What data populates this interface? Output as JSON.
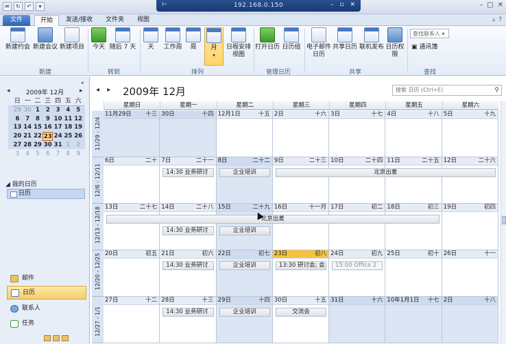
{
  "window": {
    "remote_ip": "192.168.0.150",
    "remote_controls": [
      "–",
      "▫",
      "✕"
    ],
    "controls": [
      "–",
      "□",
      "✕"
    ]
  },
  "ribbon_tabs": [
    {
      "label": "文件",
      "kind": "file"
    },
    {
      "label": "开始",
      "kind": "active"
    },
    {
      "label": "发送/接收",
      "kind": "normal"
    },
    {
      "label": "文件夹",
      "kind": "normal"
    },
    {
      "label": "视图",
      "kind": "normal"
    }
  ],
  "ribbon": {
    "buttons": [
      {
        "label": "新建约会",
        "icon": "new-appointment-icon"
      },
      {
        "label": "新建会议",
        "icon": "new-meeting-icon"
      },
      {
        "label": "新建项目",
        "icon": "new-items-icon"
      },
      {
        "label": "今天",
        "icon": "today-icon"
      },
      {
        "label": "随后 7 天",
        "icon": "next-7-days-icon"
      },
      {
        "label": "天",
        "icon": "day-view-icon"
      },
      {
        "label": "工作周",
        "icon": "work-week-icon"
      },
      {
        "label": "周",
        "icon": "week-icon"
      },
      {
        "label": "月",
        "icon": "month-icon",
        "selected": true
      },
      {
        "label": "日程安排视图",
        "icon": "schedule-view-icon"
      },
      {
        "label": "打开日历",
        "icon": "open-calendar-icon"
      },
      {
        "label": "日历组",
        "icon": "calendar-groups-icon"
      },
      {
        "label": "电子邮件日历",
        "icon": "email-calendar-icon"
      },
      {
        "label": "共享日历",
        "icon": "share-calendar-icon"
      },
      {
        "label": "联机发布",
        "icon": "publish-online-icon"
      },
      {
        "label": "日历权限",
        "icon": "calendar-permissions-icon"
      }
    ],
    "groups": [
      "新建",
      "转到",
      "排列",
      "管理日历",
      "共享",
      "查找"
    ],
    "find_placeholder": "查找联系人",
    "address_book": "通讯簿"
  },
  "mini_calendar": {
    "title": "2009年 12月",
    "weekdays": [
      "日",
      "一",
      "二",
      "三",
      "四",
      "五",
      "六"
    ],
    "weeks": [
      [
        "29",
        "30",
        "1",
        "2",
        "3",
        "4",
        "5"
      ],
      [
        "6",
        "7",
        "8",
        "9",
        "10",
        "11",
        "12"
      ],
      [
        "13",
        "14",
        "15",
        "16",
        "17",
        "18",
        "19"
      ],
      [
        "20",
        "21",
        "22",
        "23",
        "24",
        "25",
        "26"
      ],
      [
        "27",
        "28",
        "29",
        "30",
        "31",
        "1",
        "2"
      ],
      [
        "3",
        "4",
        "5",
        "6",
        "7",
        "8",
        "9"
      ]
    ],
    "today": "23"
  },
  "nav": {
    "my_calendars": "我的日历",
    "calendar_item": "日历",
    "buttons": [
      {
        "label": "邮件",
        "selected": false
      },
      {
        "label": "日历",
        "selected": true
      },
      {
        "label": "联系人",
        "selected": false
      },
      {
        "label": "任务",
        "selected": false
      }
    ]
  },
  "calendar": {
    "title": "2009年 12月",
    "search_placeholder": "搜索 日历 (Ctrl+E)",
    "weekdays": [
      "星期日",
      "星期一",
      "星期二",
      "星期三",
      "星期四",
      "星期五",
      "星期六"
    ],
    "week_labels": [
      "11/29 - 12/4",
      "12/6 - 12/11",
      "12/13 - 12/18",
      "12/20 - 12/25",
      "12/27 - 1/1"
    ],
    "weeks": [
      [
        {
          "day": "11月29日",
          "lunar": "十三",
          "off": true
        },
        {
          "day": "30日",
          "lunar": "十四",
          "off": true
        },
        {
          "day": "12月1日",
          "lunar": "十五"
        },
        {
          "day": "2日",
          "lunar": "十六"
        },
        {
          "day": "3日",
          "lunar": "十七"
        },
        {
          "day": "4日",
          "lunar": "十八"
        },
        {
          "day": "5日",
          "lunar": "十九"
        }
      ],
      [
        {
          "day": "6日",
          "lunar": "二十"
        },
        {
          "day": "7日",
          "lunar": "二十一"
        },
        {
          "day": "8日",
          "lunar": "二十二",
          "off": true
        },
        {
          "day": "9日",
          "lunar": "二十三"
        },
        {
          "day": "10日",
          "lunar": "二十四"
        },
        {
          "day": "11日",
          "lunar": "二十五"
        },
        {
          "day": "12日",
          "lunar": "二十六"
        }
      ],
      [
        {
          "day": "13日",
          "lunar": "二十七"
        },
        {
          "day": "14日",
          "lunar": "二十八"
        },
        {
          "day": "15日",
          "lunar": "二十九",
          "off": true
        },
        {
          "day": "16日",
          "lunar": "十一月"
        },
        {
          "day": "17日",
          "lunar": "初二"
        },
        {
          "day": "18日",
          "lunar": "初三"
        },
        {
          "day": "19日",
          "lunar": "初四"
        }
      ],
      [
        {
          "day": "20日",
          "lunar": "初五"
        },
        {
          "day": "21日",
          "lunar": "初六"
        },
        {
          "day": "22日",
          "lunar": "初七",
          "off": true
        },
        {
          "day": "23日",
          "lunar": "初八",
          "today": true
        },
        {
          "day": "24日",
          "lunar": "初九"
        },
        {
          "day": "25日",
          "lunar": "初十"
        },
        {
          "day": "26日",
          "lunar": "十一"
        }
      ],
      [
        {
          "day": "27日",
          "lunar": "十二"
        },
        {
          "day": "28日",
          "lunar": "十三"
        },
        {
          "day": "29日",
          "lunar": "十四",
          "off": true
        },
        {
          "day": "30日",
          "lunar": "十五"
        },
        {
          "day": "31日",
          "lunar": "十六",
          "off": true
        },
        {
          "day": "10年1月1日",
          "lunar": "十七",
          "off": true
        },
        {
          "day": "2日",
          "lunar": "十八",
          "off": true
        }
      ]
    ],
    "events": [
      {
        "week": 1,
        "start": 1,
        "span": 1,
        "text": "14:30 业务研讨"
      },
      {
        "week": 1,
        "start": 2,
        "span": 1,
        "text": "企业培训",
        "center": true
      },
      {
        "week": 1,
        "start": 3,
        "span": 4,
        "text": "北京出差",
        "center": true
      },
      {
        "week": 2,
        "start": 0,
        "span": 6,
        "text": "北京出差",
        "center": true,
        "row": 0
      },
      {
        "week": 2,
        "start": 1,
        "span": 1,
        "text": "14:30 业务研讨",
        "row": 1
      },
      {
        "week": 2,
        "start": 2,
        "span": 1,
        "text": "企业培训",
        "center": true,
        "row": 1
      },
      {
        "week": 3,
        "start": 1,
        "span": 1,
        "text": "14:30 业务研讨"
      },
      {
        "week": 3,
        "start": 2,
        "span": 1,
        "text": "企业培训",
        "center": true
      },
      {
        "week": 3,
        "start": 3,
        "span": 1,
        "text": "13:30 研讨会; 会"
      },
      {
        "week": 3,
        "start": 4,
        "span": 1,
        "text": "15:00 Office 2",
        "faint": true
      },
      {
        "week": 4,
        "start": 1,
        "span": 1,
        "text": "14:30 业务研讨"
      },
      {
        "week": 4,
        "start": 2,
        "span": 1,
        "text": "企业培训",
        "center": true
      },
      {
        "week": 4,
        "start": 3,
        "span": 1,
        "text": "交流会",
        "center": true
      }
    ]
  }
}
